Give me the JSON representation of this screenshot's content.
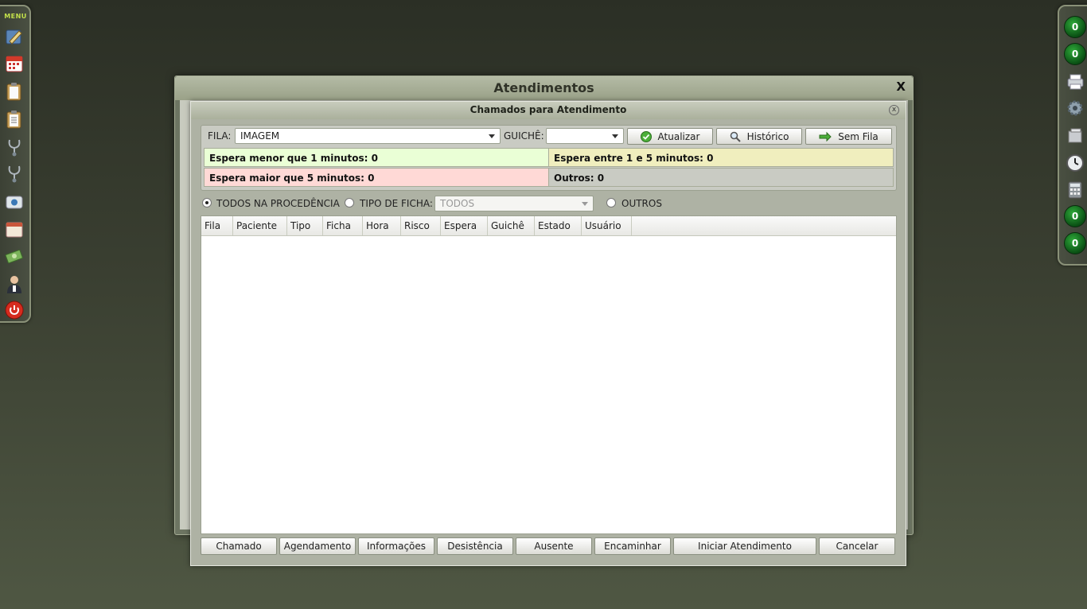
{
  "left_menu": {
    "title": "MENU",
    "icons": [
      "edit-icon",
      "calendar-icon",
      "clipboard-icon",
      "clipboard-list-icon",
      "stethoscope-icon",
      "stethoscope-alt-icon",
      "settings-box-icon",
      "calendar-alt-icon",
      "money-icon",
      "doctor-icon",
      "power-icon"
    ]
  },
  "right_bar": {
    "counter_1": "0",
    "counter_2": "0",
    "counter_3": "0",
    "counter_4": "0"
  },
  "outer_dialog": {
    "title": "Atendimentos",
    "close_label": "X"
  },
  "inner_dialog": {
    "title": "Chamados para Atendimento",
    "close_label": "x",
    "fila_label": "FILA:",
    "fila_value": "IMAGEM",
    "guiche_label": "GUICHÊ:",
    "guiche_value": "",
    "atualizar_label": "Atualizar",
    "historico_label": "Histórico",
    "sem_fila_label": "Sem Fila",
    "status": {
      "menor_1": "Espera menor que 1 minutos: 0",
      "entre_1_5": "Espera entre 1 e 5 minutos: 0",
      "maior_5": "Espera maior que 5 minutos: 0",
      "outros": "Outros: 0"
    },
    "status_colors": {
      "menor_1": "#eaffd6",
      "entre_1_5": "#f0eebe",
      "maior_5": "#ffd9d6",
      "outros": "#c9cbc3"
    },
    "radio_todos_label": "TODOS NA PROCEDÊNCIA",
    "radio_tipo_label": "TIPO DE FICHA:",
    "tipo_ficha_value": "TODOS",
    "radio_outros_label": "OUTROS",
    "columns": [
      "Fila",
      "Paciente",
      "Tipo",
      "Ficha",
      "Hora",
      "Risco",
      "Espera",
      "Guichê",
      "Estado",
      "Usuário"
    ],
    "buttons": {
      "chamado": "Chamado",
      "agendamento": "Agendamento",
      "informacoes": "Informações",
      "desistencia": "Desistência",
      "ausente": "Ausente",
      "encaminhar": "Encaminhar",
      "iniciar": "Iniciar Atendimento",
      "cancelar": "Cancelar"
    }
  }
}
